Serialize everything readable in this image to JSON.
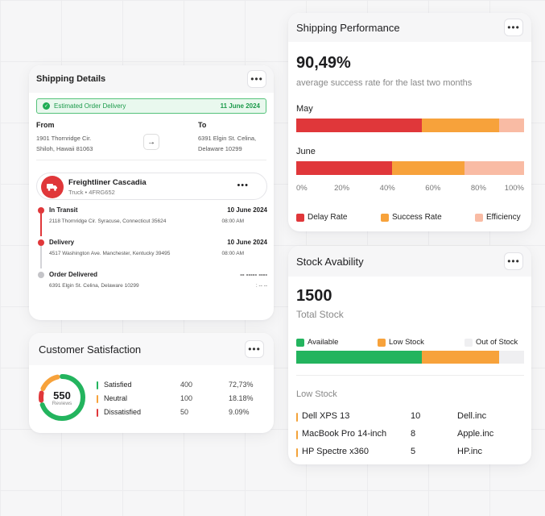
{
  "colors": {
    "red": "#e0373a",
    "orange": "#f7a23b",
    "peach": "#f9bba4",
    "green": "#23b45e",
    "gray": "#efeff1"
  },
  "shipping_details": {
    "title": "Shipping Details",
    "menu_icon": "more-horizontal-icon",
    "estimated_label": "Estimated Order Delivery",
    "estimated_date": "11 June 2024",
    "from_label": "From",
    "from_address_line1": "1901 Thornridge Cir.",
    "from_address_line2": "Shiloh, Hawaii 81063",
    "to_label": "To",
    "to_address_line1": "6391 Elgin St. Celina,",
    "to_address_line2": "Delaware 10299",
    "vehicle_name": "Freightliner Cascadia",
    "vehicle_sub": "Truck • 4FRG652",
    "timeline": [
      {
        "status": "In Transit",
        "address": "2118 Thornridge Cir. Syracuse, Connecticut 35624",
        "date": "10 June 2024",
        "time": "08:00 AM"
      },
      {
        "status": "Delivery",
        "address": "4517 Washington Ave. Manchester, Kentucky 39495",
        "date": "10 June 2024",
        "time": "08:00 AM"
      },
      {
        "status": "Order Delivered",
        "address": "6391 Elgin St. Celina, Delaware 10299",
        "date": "-- ----- ----",
        "time": ": -- --"
      }
    ]
  },
  "customer_satisfaction": {
    "title": "Customer Satisfaction",
    "total": "550",
    "total_label": "Reviews",
    "rows": [
      {
        "name": "Satisfied",
        "count": "400",
        "percent": "72,73%",
        "share": 0.7273,
        "color": "#23b45e"
      },
      {
        "name": "Neutral",
        "count": "100",
        "percent": "18.18%",
        "share": 0.1818,
        "color": "#f7a23b"
      },
      {
        "name": "Dissatisfied",
        "count": "50",
        "percent": "9.09%",
        "share": 0.0909,
        "color": "#e0373a"
      }
    ]
  },
  "shipping_performance": {
    "title": "Shipping Performance",
    "rate": "90,49%",
    "rate_caption": "average success rate for the last two months",
    "months": [
      {
        "label": "May",
        "segments": [
          55,
          34,
          11
        ]
      },
      {
        "label": "June",
        "segments": [
          42,
          32,
          26
        ]
      }
    ],
    "ticks": [
      "0%",
      "20%",
      "40%",
      "60%",
      "80%",
      "100%"
    ],
    "legend": [
      "Delay Rate",
      "Success Rate",
      "Efficiency"
    ]
  },
  "stock": {
    "title": "Stock Avability",
    "total": "1500",
    "total_label": "Total Stock",
    "legend": [
      "Available",
      "Low Stock",
      "Out of Stock"
    ],
    "segments": [
      55,
      34,
      11
    ],
    "low_stock_title": "Low Stock",
    "items": [
      {
        "name": "Dell XPS 13",
        "qty": "10",
        "brand": "Dell.inc"
      },
      {
        "name": "MacBook Pro 14-inch",
        "qty": "8",
        "brand": "Apple.inc"
      },
      {
        "name": "HP Spectre x360",
        "qty": "5",
        "brand": "HP.inc"
      }
    ]
  }
}
